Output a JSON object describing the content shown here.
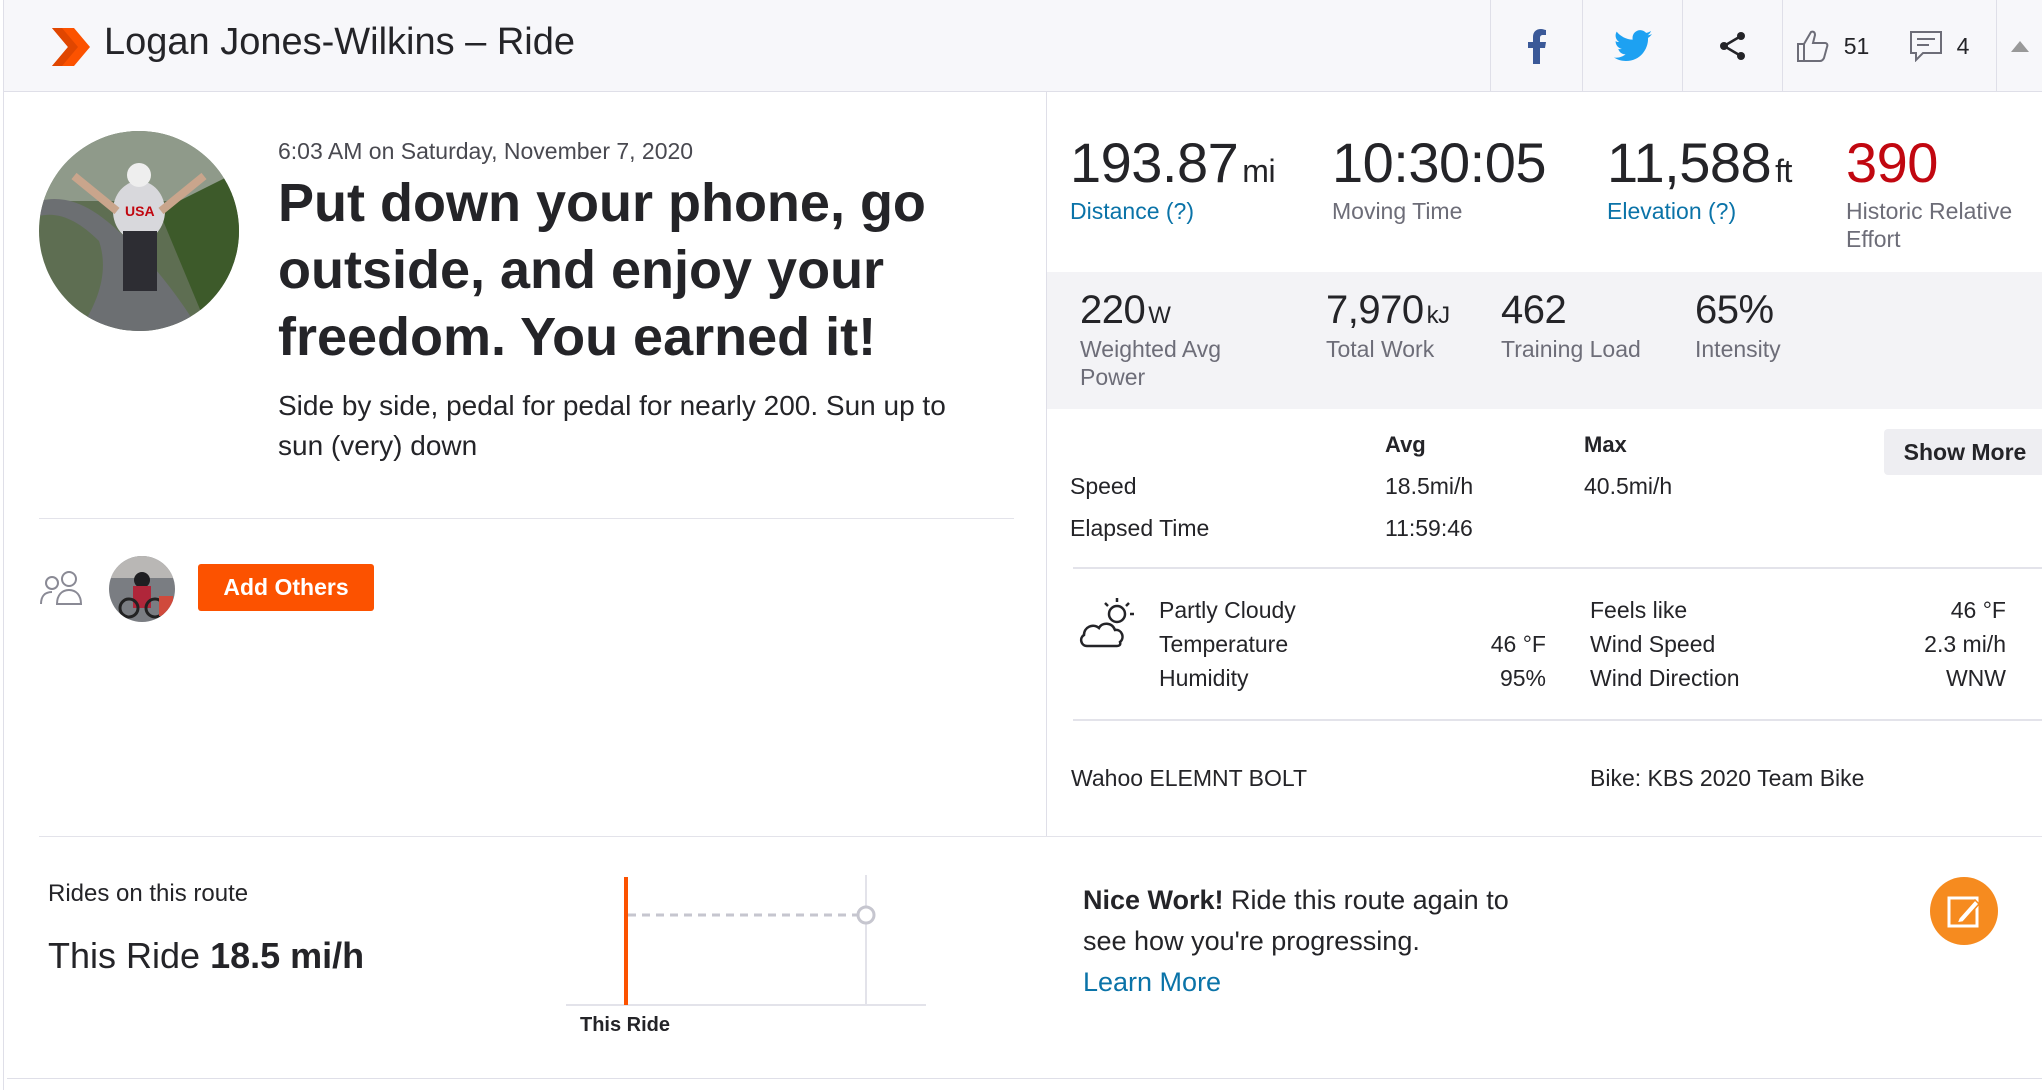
{
  "header": {
    "title": "Logan Jones-Wilkins – Ride",
    "kudos_count": "51",
    "comment_count": "4",
    "icons": [
      "strava-chevron-icon",
      "facebook-icon",
      "twitter-icon",
      "share-icon",
      "thumbs-up-icon",
      "comment-icon"
    ]
  },
  "activity": {
    "datetime": "6:03 AM on Saturday, November 7, 2020",
    "title": "Put down your phone, go outside, and enjoy your freedom. You earned it!",
    "description": "Side by side, pedal for pedal for nearly 200. Sun up to sun (very) down"
  },
  "group": {
    "add_others_label": "Add Others"
  },
  "primary_stats": [
    {
      "value": "193.87",
      "unit": "mi",
      "label": "Distance (?)"
    },
    {
      "value": "10:30:05",
      "unit": "",
      "label": "Moving Time"
    },
    {
      "value": "11,588",
      "unit": "ft",
      "label": "Elevation (?)"
    },
    {
      "value": "390",
      "unit": "",
      "label": "Historic Relative Effort"
    }
  ],
  "secondary_stats": [
    {
      "value": "220",
      "unit": "W",
      "label": "Weighted Avg Power"
    },
    {
      "value": "7,970",
      "unit": "kJ",
      "label": "Total Work"
    },
    {
      "value": "462",
      "unit": "",
      "label": "Training Load"
    },
    {
      "value": "65%",
      "unit": "",
      "label": "Intensity"
    }
  ],
  "summary_table": {
    "headers": {
      "avg": "Avg",
      "max": "Max"
    },
    "rows": [
      {
        "label": "Speed",
        "avg": "18.5mi/h",
        "max": "40.5mi/h"
      },
      {
        "label": "Elapsed Time",
        "avg": "11:59:46",
        "max": ""
      }
    ],
    "show_more_label": "Show More"
  },
  "weather": {
    "condition": "Partly Cloudy",
    "temperature_label": "Temperature",
    "temperature_value": "46 °F",
    "humidity_label": "Humidity",
    "humidity_value": "95%",
    "feels_like_label": "Feels like",
    "feels_like_value": "46 °F",
    "wind_speed_label": "Wind Speed",
    "wind_speed_value": "2.3 mi/h",
    "wind_direction_label": "Wind Direction",
    "wind_direction_value": "WNW"
  },
  "gear": {
    "device": "Wahoo ELEMNT BOLT",
    "bike": "Bike: KBS 2020 Team Bike"
  },
  "route": {
    "heading": "Rides on this route",
    "this_ride_prefix": "This Ride",
    "this_ride_speed": "18.5 mi/h",
    "chart_label": "This Ride"
  },
  "promo": {
    "strong": "Nice Work!",
    "text": " Ride this route again to see how you're progressing.",
    "link": "Learn More"
  },
  "colors": {
    "brand": "#fc5200",
    "link": "#0a73a8",
    "effort_red": "#c10710"
  }
}
